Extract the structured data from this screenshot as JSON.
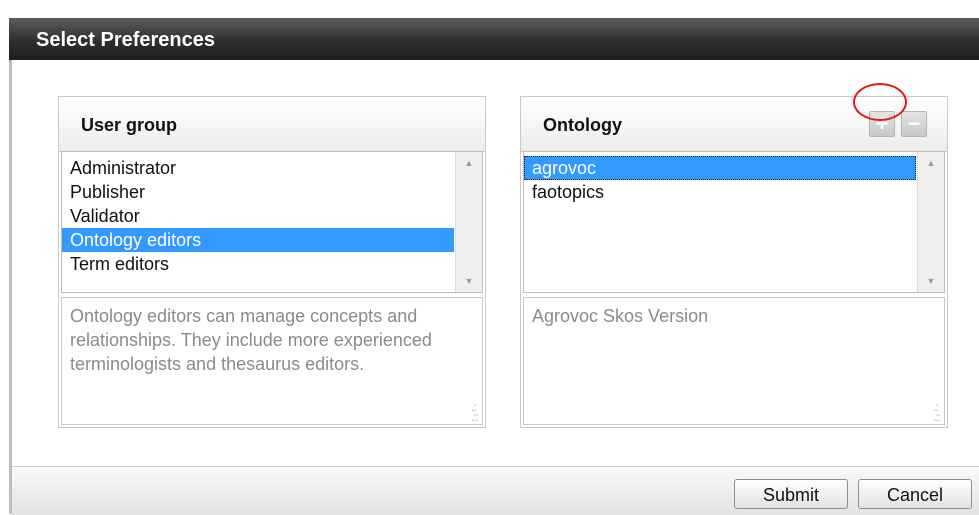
{
  "dialog": {
    "title": "Select Preferences"
  },
  "user_group": {
    "title": "User group",
    "items": [
      {
        "label": "Administrator",
        "selected": false
      },
      {
        "label": "Publisher",
        "selected": false
      },
      {
        "label": "Validator",
        "selected": false
      },
      {
        "label": "Ontology editors",
        "selected": true
      },
      {
        "label": "Term editors",
        "selected": false
      }
    ],
    "description": "Ontology editors can manage concepts and relationships. They include more experienced terminologists and thesaurus editors."
  },
  "ontology": {
    "title": "Ontology",
    "add_label": "+",
    "remove_label": "−",
    "items": [
      {
        "label": "agrovoc",
        "selected": true
      },
      {
        "label": "faotopics",
        "selected": false
      }
    ],
    "description": "Agrovoc Skos Version"
  },
  "footer": {
    "submit_label": "Submit",
    "cancel_label": "Cancel"
  },
  "colors": {
    "selection": "#3399ff",
    "titlebar": "#2f2f2f",
    "highlight_circle": "#e41616"
  }
}
